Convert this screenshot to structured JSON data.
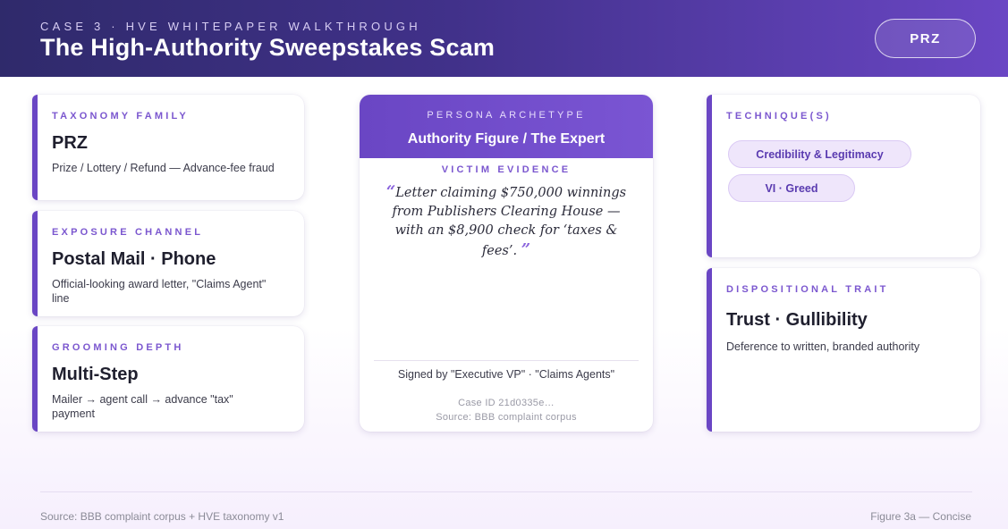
{
  "header": {
    "kicker": "CASE 3 · HVE WHITEPAPER WALKTHROUGH",
    "title": "The High-Authority Sweepstakes Scam",
    "code": "PRZ"
  },
  "left_cards": [
    {
      "label": "TAXONOMY FAMILY",
      "value": "PRZ",
      "desc": "Prize / Lottery / Refund — Advance-fee fraud"
    },
    {
      "label": "EXPOSURE CHANNEL",
      "value": "Postal Mail · Phone",
      "desc": "Official-looking award letter, \"Claims Agent\" line"
    },
    {
      "label": "GROOMING DEPTH",
      "value": "Multi-Step",
      "desc": "Mailer → agent call → advance \"tax\" payment"
    }
  ],
  "center": {
    "persona_label": "PERSONA ARCHETYPE",
    "persona_value": "Authority Figure / The Expert",
    "evidence_label": "VICTIM EVIDENCE",
    "open_quote": "“",
    "quote": "Letter claiming $750,000 winnings from Publishers Clearing House — with an $8,900 check for ‘taxes & fees’.",
    "close_quote": "”",
    "signed": "Signed by \"Executive VP\" · \"Claims Agents\"",
    "case_id": "Case ID 21d0335e…",
    "source": "Source: BBB complaint corpus"
  },
  "techniques": {
    "label": "TECHNIQUE(S)",
    "items": [
      "Credibility & Legitimacy",
      "VI · Greed"
    ]
  },
  "trait": {
    "label": "DISPOSITIONAL TRAIT",
    "value": "Trust · Gullibility",
    "desc": "Deference to written, branded authority"
  },
  "footer": {
    "left": "Source: BBB complaint corpus + HVE taxonomy v1",
    "right": "Figure 3a — Concise"
  }
}
